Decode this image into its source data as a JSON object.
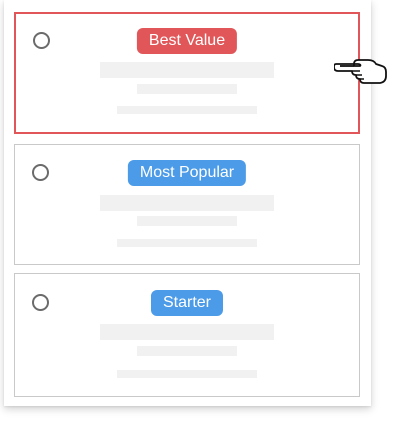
{
  "plans": [
    {
      "badge_label": "Best Value",
      "badge_color": "#e15759",
      "selected": true
    },
    {
      "badge_label": "Most Popular",
      "badge_color": "#4c9be8",
      "selected": false
    },
    {
      "badge_label": "Starter",
      "badge_color": "#4c9be8",
      "selected": false
    }
  ],
  "cursor": {
    "icon": "pointing-hand-icon"
  }
}
